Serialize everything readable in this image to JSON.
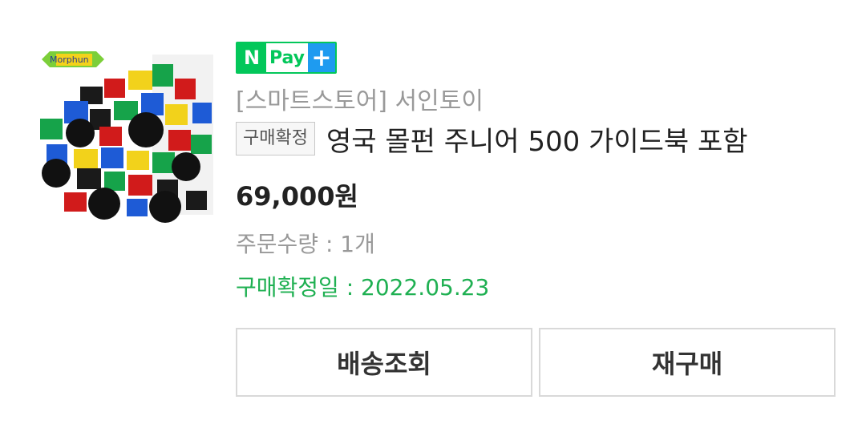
{
  "product": {
    "image_alt": "Morphun blocks",
    "image_logo_text": "Morphun",
    "npay": {
      "n_label": "N",
      "pay_label": "Pay",
      "plus_label": "+"
    },
    "store_label": "[스마트스토어] 서인토이",
    "status_badge": "구매확정",
    "title": "영국 몰펀 주니어 500 가이드북 포함",
    "price": "69,000원",
    "quantity_text": "주문수량 : 1개",
    "confirm_date_text": "구매확정일 : 2022.05.23"
  },
  "actions": {
    "track_label": "배송조회",
    "reorder_label": "재구매"
  },
  "colors": {
    "npay_green": "#03c75a",
    "npay_blue": "#1e9bf0",
    "confirm_green": "#1fb052",
    "muted_gray": "#999999"
  }
}
